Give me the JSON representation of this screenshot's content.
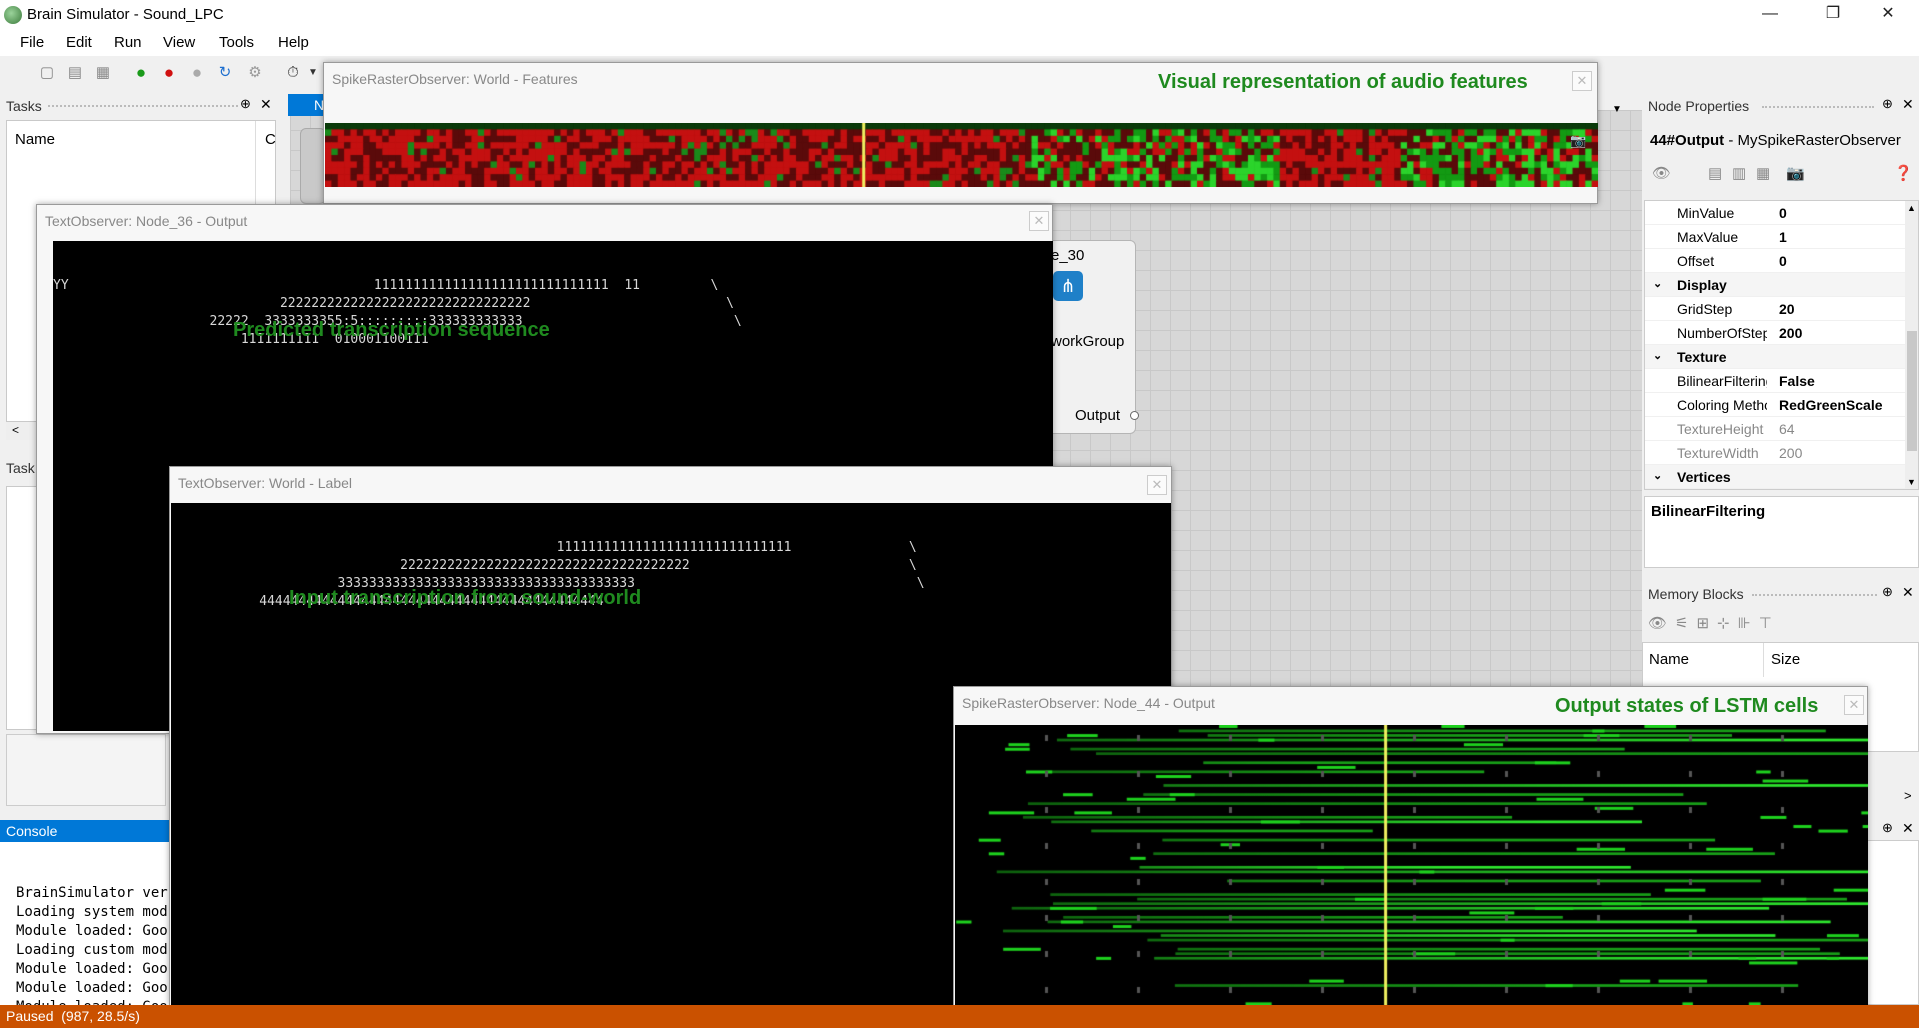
{
  "window": {
    "title": "Brain Simulator - Sound_LPC",
    "minimize": "—",
    "restore": "❐",
    "close": "✕"
  },
  "menu": [
    "File",
    "Edit",
    "Run",
    "View",
    "Tools",
    "Help"
  ],
  "toolbar": [
    "new-icon",
    "open-icon",
    "save-icon",
    "run-icon",
    "stop-icon",
    "pause-icon",
    "step-icon",
    "debug-icon",
    "timer-icon"
  ],
  "colors": {
    "status": "#ca5100",
    "annotation": "#1f8a1f",
    "console_tab": "#0078d7"
  },
  "tasks": {
    "title": "Tasks",
    "pin": "⊕",
    "close": "✕",
    "column_name": "Name",
    "column_c": "C",
    "tasks2_label": "Task"
  },
  "graph": {
    "node_label": "e_30",
    "node_caption": "workGroup",
    "output_label": "Output",
    "tab_label": "N"
  },
  "features_observer": {
    "title": "SpikeRasterObserver: World - Features",
    "annotation": "Visual representation of audio features",
    "close": "✕"
  },
  "node36_observer": {
    "title": "TextObserver: Node_36 - Output",
    "annotation": "Predicted transcription sequence",
    "close": "✕",
    "lines": [
      "YY                                       111111111111111111111111111111  11         \\",
      "                             22222222222222222222222222222222                         \\",
      "                    22222  3333333355:5:::::::::333333333333                           \\",
      "                        1111111111  010001100111"
    ]
  },
  "label_observer": {
    "title": "TextObserver: World - Label",
    "annotation": "Input transcription from sound-world",
    "close": "✕",
    "lines": [
      "                                                111111111111111111111111111111               \\",
      "                            2222222222222222222222222222222222222                            \\",
      "                    33333333333333333333333333333333333333                                    \\",
      "          44444444444444444444444444444444444444444444"
    ]
  },
  "node44_observer": {
    "title": "SpikeRasterObserver: Node_44 - Output",
    "annotation": "Output states of LSTM cells",
    "close": "✕"
  },
  "node_properties": {
    "title": "Node Properties",
    "selected": "44#Output",
    "selected_type": " - MySpikeRasterObserver",
    "rows": [
      {
        "name": "MinValue",
        "value": "0",
        "category": false,
        "dim": false
      },
      {
        "name": "MaxValue",
        "value": "1",
        "category": false,
        "dim": false
      },
      {
        "name": "Offset",
        "value": "0",
        "category": false,
        "dim": false
      },
      {
        "name": "Display",
        "value": "",
        "category": true,
        "dim": false
      },
      {
        "name": "GridStep",
        "value": "20",
        "category": false,
        "dim": false
      },
      {
        "name": "NumberOfSteps",
        "value": "200",
        "category": false,
        "dim": false
      },
      {
        "name": "Texture",
        "value": "",
        "category": true,
        "dim": false
      },
      {
        "name": "BilinearFiltering",
        "value": "False",
        "category": false,
        "dim": false
      },
      {
        "name": "Coloring Method",
        "value": "RedGreenScale",
        "category": false,
        "dim": false
      },
      {
        "name": "TextureHeight",
        "value": "64",
        "category": false,
        "dim": true
      },
      {
        "name": "TextureWidth",
        "value": "200",
        "category": false,
        "dim": true
      },
      {
        "name": "Vertices",
        "value": "",
        "category": true,
        "dim": false
      }
    ],
    "description": "BilinearFiltering"
  },
  "memory_blocks": {
    "title": "Memory Blocks",
    "col_name": "Name",
    "col_size": "Size"
  },
  "console": {
    "title": "Console",
    "lines": [
      "BrainSimulator ver",
      "Loading system mod",
      "Module loaded: Goo",
      "Loading custom mod",
      "Module loaded: Goo",
      "Module loaded: Goo",
      "Module loaded: Goo",
      "Module loaded: Goo"
    ]
  },
  "status": {
    "text": "Paused  (987, 28.5/s)"
  }
}
